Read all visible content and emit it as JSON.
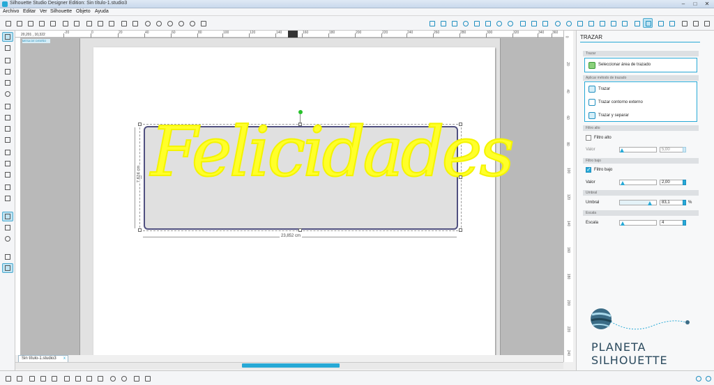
{
  "window": {
    "title": "Silhouette Studio Designer Edition: Sin título-1.studio3"
  },
  "menu": [
    "Archivo",
    "Editar",
    "Ver",
    "Silhouette",
    "Objeto",
    "Ayuda"
  ],
  "canvas": {
    "coords": "20,201 , 10,322",
    "origin_label": "MESA DE DISEÑO",
    "text": "Felicidades",
    "width_dim": "23,852 cm",
    "height_dim": "7,624 cm",
    "ruler_top": [
      "-20",
      "0",
      "20",
      "40",
      "60",
      "80",
      "100",
      "120",
      "140",
      "160",
      "180",
      "200",
      "220",
      "240",
      "260",
      "280",
      "300",
      "320",
      "340",
      "360"
    ],
    "ruler_right": [
      "0",
      "20",
      "40",
      "60",
      "80",
      "100",
      "120",
      "140",
      "160",
      "180",
      "200",
      "220",
      "240"
    ]
  },
  "tabs": {
    "document": "Sin título-1.studio3",
    "close": "x"
  },
  "panel": {
    "title": "TRAZAR",
    "sec_trazar": "Trazar",
    "select_area": "Seleccionar área de trazado",
    "sec_method": "Aplicar método de trazado",
    "method_trazar": "Trazar",
    "method_contorno": "Trazar contorno externo",
    "method_separar": "Trazar y separar",
    "sec_filtro_alto": "Filtro alto",
    "filtro_alto": "Filtro alto",
    "filtro_alto_checked": false,
    "valor_alto_label": "Valor",
    "valor_alto": "5,00",
    "sec_filtro_bajo": "Filtro bajo",
    "filtro_bajo": "Filtro bajo",
    "filtro_bajo_checked": true,
    "valor_bajo_label": "Valor",
    "valor_bajo": "2,00",
    "sec_umbral": "Umbral",
    "umbral_label": "Umbral",
    "umbral": "83,1",
    "umbral_unit": "%",
    "umbral_level": 0.83,
    "sec_escala": "Escala",
    "escala_label": "Escala",
    "escala": "4",
    "valor_bajo_level": 0.02,
    "escala_level": 0.03
  },
  "logo": {
    "text": "PLANETA SILHOUETTE"
  },
  "colors": {
    "accent": "#27a9d6",
    "trace_text": "#ffff2a",
    "selection_border": "#505080"
  }
}
